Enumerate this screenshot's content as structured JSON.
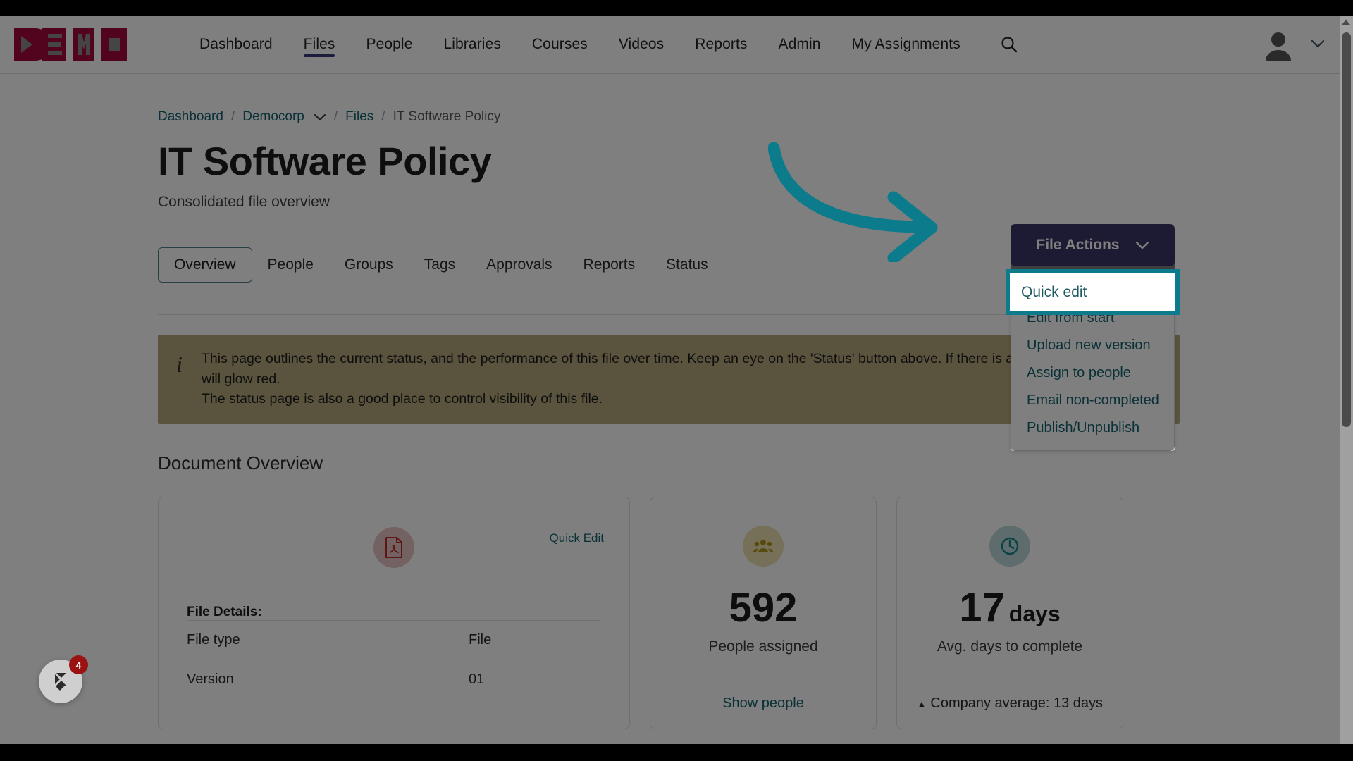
{
  "brand": {
    "logo_text": "DEMO",
    "logo_color": "#a4063b",
    "accent_purple": "#3b3569",
    "accent_teal": "#0c7b8c",
    "link_teal": "#14626e"
  },
  "topnav": {
    "items": [
      {
        "label": "Dashboard",
        "active": false
      },
      {
        "label": "Files",
        "active": true
      },
      {
        "label": "People",
        "active": false
      },
      {
        "label": "Libraries",
        "active": false
      },
      {
        "label": "Courses",
        "active": false
      },
      {
        "label": "Videos",
        "active": false
      },
      {
        "label": "Reports",
        "active": false
      },
      {
        "label": "Admin",
        "active": false
      },
      {
        "label": "My Assignments",
        "active": false
      }
    ],
    "search_icon": "search-icon",
    "avatar_icon": "user-avatar-icon",
    "avatar_caret": "∨"
  },
  "breadcrumb": {
    "items": [
      {
        "label": "Dashboard",
        "type": "link"
      },
      {
        "label": "/",
        "type": "sep"
      },
      {
        "label": "Democorp",
        "type": "link",
        "has_caret": true
      },
      {
        "label": "/",
        "type": "sep"
      },
      {
        "label": "Files",
        "type": "link"
      },
      {
        "label": "/",
        "type": "sep"
      },
      {
        "label": "IT Software Policy",
        "type": "current"
      }
    ]
  },
  "page": {
    "title": "IT Software Policy",
    "subtitle": "Consolidated file overview"
  },
  "tabs": [
    {
      "label": "Overview",
      "selected": true
    },
    {
      "label": "People",
      "selected": false
    },
    {
      "label": "Groups",
      "selected": false
    },
    {
      "label": "Tags",
      "selected": false
    },
    {
      "label": "Approvals",
      "selected": false
    },
    {
      "label": "Reports",
      "selected": false
    },
    {
      "label": "Status",
      "selected": false
    }
  ],
  "info_banner": {
    "icon": "info-icon",
    "line1": "This page outlines the current status, and the performance of this file over time. Keep an eye on the 'Status' button above. If there is a problem with this file, it will glow red.",
    "line2": "The status page is also a good place to control visibility of this file."
  },
  "section": {
    "heading": "Document Overview"
  },
  "file_actions": {
    "button_label": "File Actions",
    "caret": "∨",
    "menu_items": [
      "Quick edit",
      "Edit from start",
      "Upload new version",
      "Assign to people",
      "Email non-completed",
      "Publish/Unpublish"
    ],
    "highlighted_item": "Quick edit"
  },
  "cards": {
    "details": {
      "icon": "pdf-file-icon",
      "quick_edit_label": "Quick Edit",
      "details_label": "File Details:",
      "rows": [
        {
          "key": "File type",
          "value": "File"
        },
        {
          "key": "Version",
          "value": "01"
        }
      ]
    },
    "people": {
      "icon": "people-group-icon",
      "value": "592",
      "label": "People assigned",
      "footer": "Show people"
    },
    "days": {
      "icon": "clock-icon",
      "value": "17",
      "unit": "days",
      "label": "Avg. days to complete",
      "footer_marker": "▲",
      "footer": "Company average:  13 days"
    }
  },
  "widget": {
    "icon": "chat-widget-icon",
    "badge_count": "4"
  },
  "scrollbar": {
    "up_arrow": "scroll-up-arrow"
  }
}
